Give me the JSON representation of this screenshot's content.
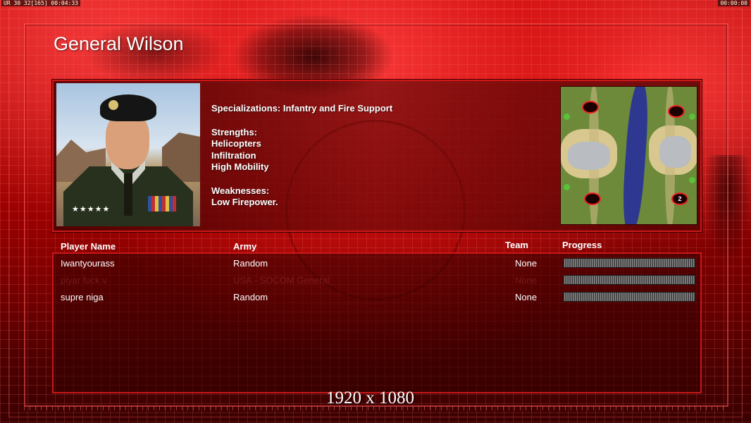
{
  "hud": {
    "left": "UR 30 32[165] 00:04:33",
    "right": "00:00:00"
  },
  "general": {
    "name": "General Wilson",
    "specializations": "Specializations: Infantry and Fire Support",
    "strengths_label": "Strengths:",
    "strengths": [
      "Helicopters",
      "Infiltration",
      "High Mobility"
    ],
    "weaknesses_label": "Weaknesses:",
    "weaknesses": [
      "Low Firepower."
    ],
    "rank_stars": "★★★★★"
  },
  "map": {
    "spawn_label": "2"
  },
  "table": {
    "headers": {
      "player": "Player Name",
      "army": "Army",
      "team": "Team",
      "progress": "Progress"
    },
    "rows": [
      {
        "player": "Iwantyourass",
        "army": "Random",
        "team": "None",
        "progress": 0
      },
      {
        "player": "plyar fuck v",
        "army": "USA - SOCOM General",
        "team": "None",
        "progress": 0
      },
      {
        "player": "supre niga",
        "army": "Random",
        "team": "None",
        "progress": 0
      }
    ]
  },
  "overlay": {
    "resolution": "1920 x 1080"
  },
  "colors": {
    "accent": "#d01818",
    "background": "#8a0000",
    "progress_fill": "#4ad04a"
  }
}
